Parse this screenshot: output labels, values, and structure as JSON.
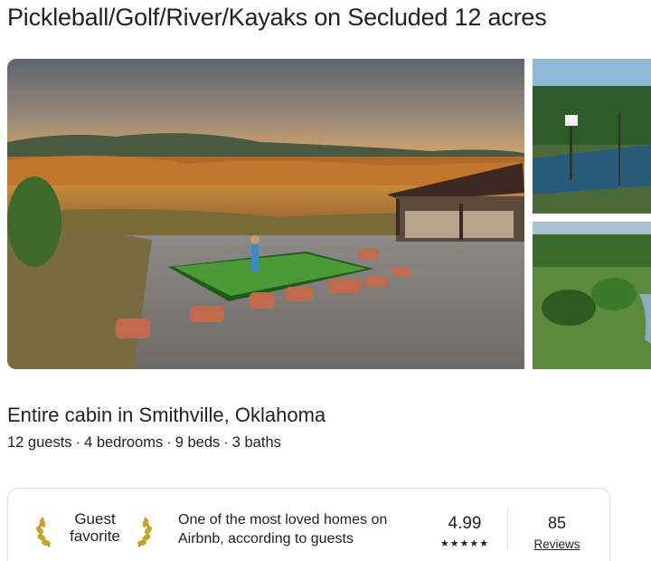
{
  "listing": {
    "title": "Pickleball/Golf/River/Kayaks on Secluded 12 acres",
    "subtitle": "Entire cabin in Smithville, Oklahoma",
    "details": [
      "12 guests",
      "4 bedrooms",
      "9 beds",
      "3 baths"
    ],
    "details_separator": "·"
  },
  "photos": {
    "main_alt": "Putting green with river valley view at sunset",
    "top_alt": "Pickleball court",
    "bottom_alt": "Aerial view of forest and river"
  },
  "guest_favorite": {
    "label_line1": "Guest",
    "label_line2": "favorite",
    "description": "One of the most loved homes on Airbnb, according to guests",
    "rating": "4.99",
    "stars": "★★★★★",
    "reviews_count": "85",
    "reviews_label": "Reviews"
  },
  "colors": {
    "text": "#222222",
    "border": "#dddddd",
    "laurel_gold": "#c9a227"
  }
}
